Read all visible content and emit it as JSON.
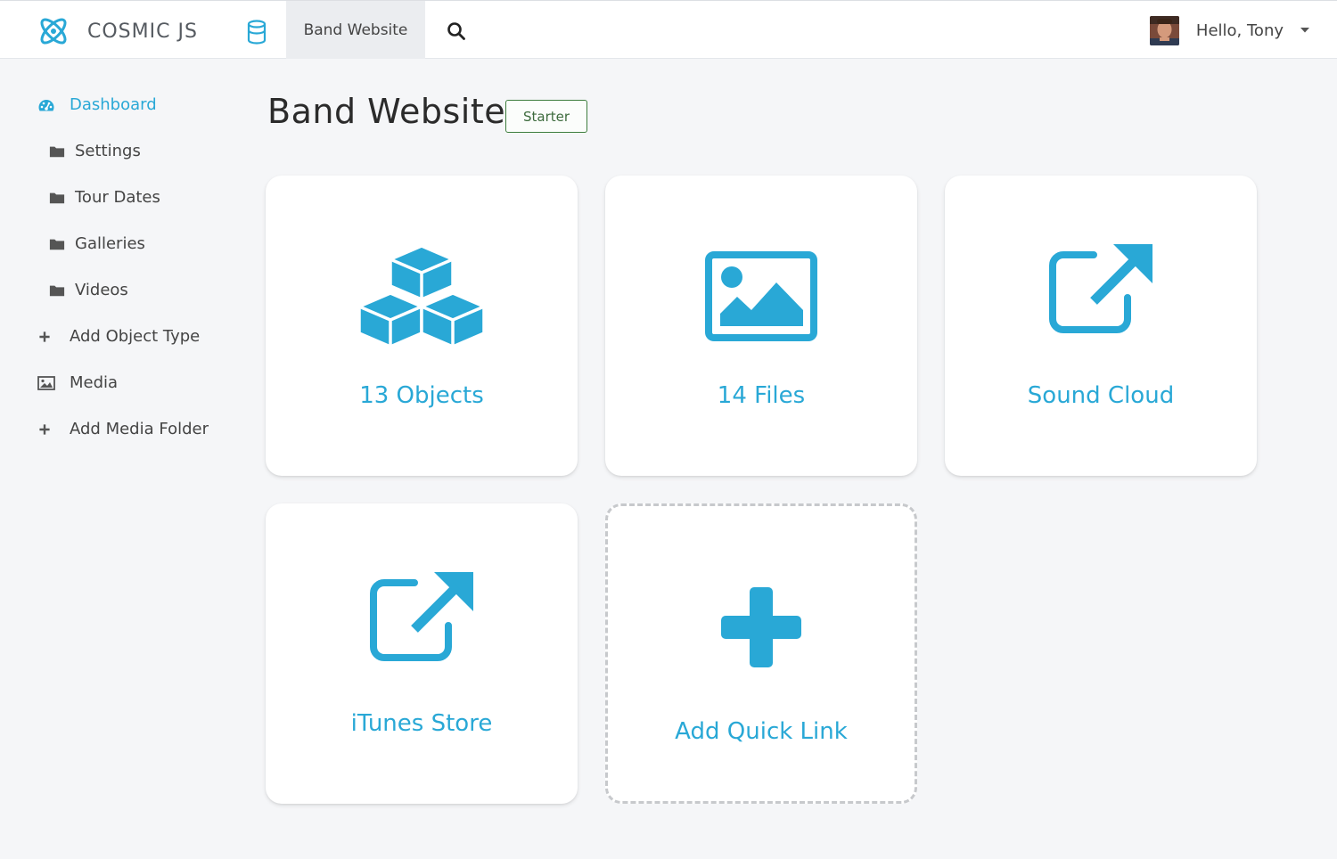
{
  "app": {
    "brand": "COSMIC JS",
    "bucket_tab": "Band Website",
    "user_greeting": "Hello, Tony"
  },
  "icons": {
    "logo": "cosmic-atom-logo",
    "bucket": "database-icon",
    "search": "search-icon",
    "user_menu": "caret-down-icon"
  },
  "colors": {
    "accent": "#29a8d6",
    "badge_border": "#3d7d3d",
    "text": "#444444"
  },
  "sidebar": {
    "items": [
      {
        "label": "Dashboard",
        "icon": "dashboard-icon",
        "active": true
      },
      {
        "label": "Settings",
        "icon": "folder-icon"
      },
      {
        "label": "Tour Dates",
        "icon": "folder-icon"
      },
      {
        "label": "Galleries",
        "icon": "folder-icon"
      },
      {
        "label": "Videos",
        "icon": "folder-icon"
      },
      {
        "label": "Add Object Type",
        "icon": "plus-icon"
      },
      {
        "label": "Media",
        "icon": "image-icon"
      },
      {
        "label": "Add Media Folder",
        "icon": "plus-icon"
      }
    ]
  },
  "main": {
    "title": "Band Website",
    "plan_badge": "Starter",
    "cards": [
      {
        "label": "13 Objects",
        "icon": "cubes-icon"
      },
      {
        "label": "14 Files",
        "icon": "image-icon"
      },
      {
        "label": "Sound Cloud",
        "icon": "external-link-icon"
      },
      {
        "label": "iTunes Store",
        "icon": "external-link-icon"
      },
      {
        "label": "Add Quick Link",
        "icon": "plus-icon"
      }
    ]
  }
}
